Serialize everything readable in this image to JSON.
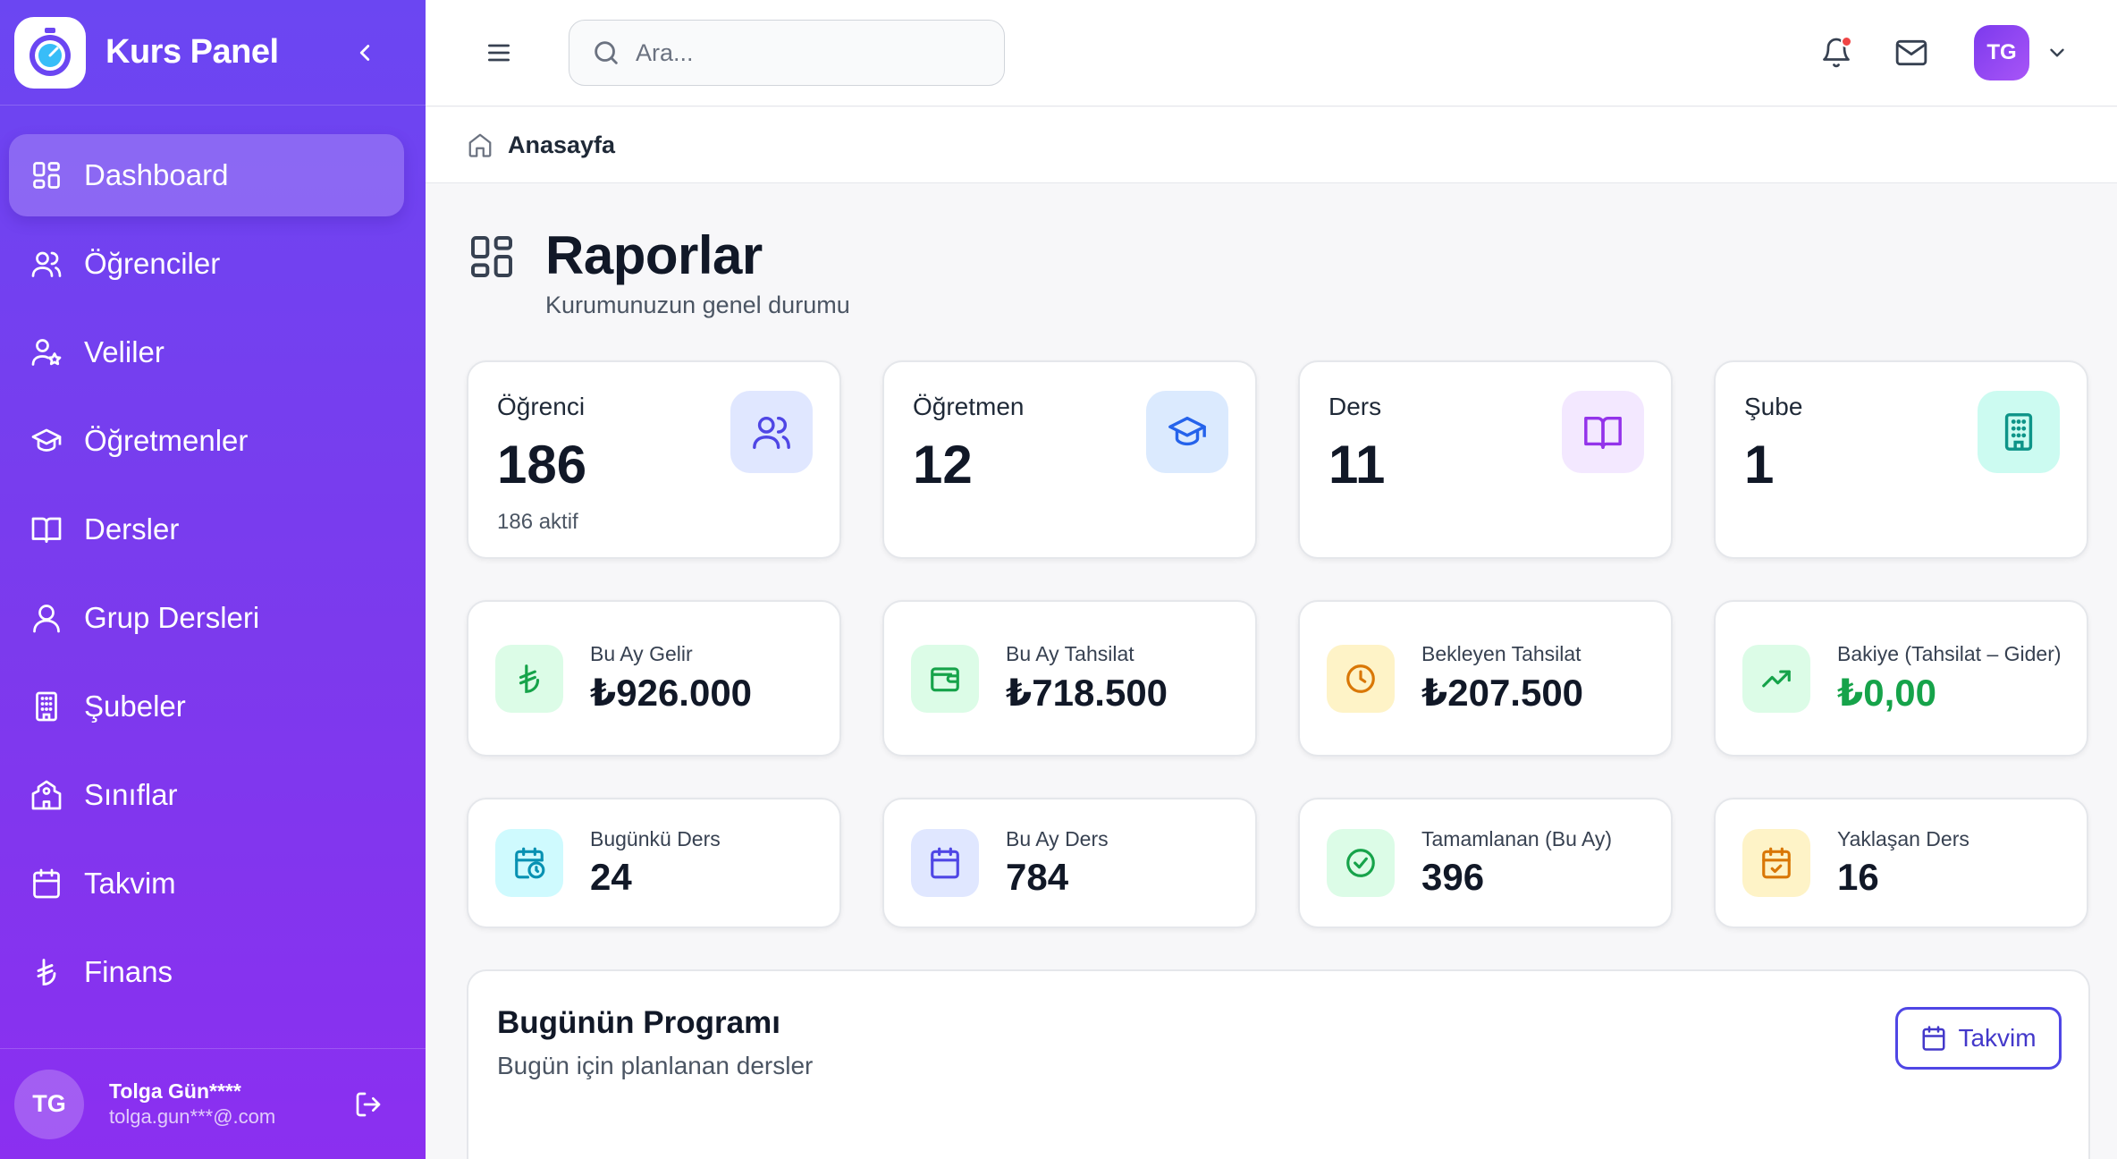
{
  "brand": {
    "title": "Kurs Panel"
  },
  "sidebar": {
    "items": [
      {
        "label": "Dashboard",
        "icon": "dashboard-icon",
        "active": true
      },
      {
        "label": "Öğrenciler",
        "icon": "users-icon"
      },
      {
        "label": "Veliler",
        "icon": "user-star-icon"
      },
      {
        "label": "Öğretmenler",
        "icon": "graduation-cap-icon"
      },
      {
        "label": "Dersler",
        "icon": "book-icon"
      },
      {
        "label": "Grup Dersleri",
        "icon": "user-icon"
      },
      {
        "label": "Şubeler",
        "icon": "building-icon"
      },
      {
        "label": "Sınıflar",
        "icon": "school-icon"
      },
      {
        "label": "Takvim",
        "icon": "calendar-icon"
      },
      {
        "label": "Finans",
        "icon": "lira-icon"
      }
    ],
    "user": {
      "initials": "TG",
      "name": "Tolga Gün****",
      "email": "tolga.gun***@.com"
    }
  },
  "header": {
    "search_placeholder": "Ara...",
    "avatar_initials": "TG"
  },
  "breadcrumb": {
    "label": "Anasayfa"
  },
  "page": {
    "title": "Raporlar",
    "subtitle": "Kurumunuzun genel durumu"
  },
  "stats": [
    {
      "label": "Öğrenci",
      "value": "186",
      "note": "186 aktif",
      "icon": "users-icon"
    },
    {
      "label": "Öğretmen",
      "value": "12",
      "note": "",
      "icon": "graduation-cap-icon"
    },
    {
      "label": "Ders",
      "value": "11",
      "note": "",
      "icon": "book-icon"
    },
    {
      "label": "Şube",
      "value": "1",
      "note": "",
      "icon": "building-icon"
    }
  ],
  "finance": [
    {
      "label": "Bu Ay Gelir",
      "value": "₺926.000",
      "icon": "lira-icon"
    },
    {
      "label": "Bu Ay Tahsilat",
      "value": "₺718.500",
      "icon": "wallet-icon"
    },
    {
      "label": "Bekleyen Tahsilat",
      "value": "₺207.500",
      "icon": "clock-icon"
    },
    {
      "label": "Bakiye (Tahsilat – Gider)",
      "value": "₺0,00",
      "icon": "trending-up-icon"
    }
  ],
  "lessons": [
    {
      "label": "Bugünkü Ders",
      "value": "24",
      "icon": "calendar-clock-icon"
    },
    {
      "label": "Bu Ay Ders",
      "value": "784",
      "icon": "calendar-icon"
    },
    {
      "label": "Tamamlanan (Bu Ay)",
      "value": "396",
      "icon": "check-circle-icon"
    },
    {
      "label": "Yaklaşan Ders",
      "value": "16",
      "icon": "calendar-check-icon"
    }
  ],
  "program": {
    "title": "Bugünün Programı",
    "subtitle": "Bugün için planlanan dersler",
    "button_label": "Takvim"
  },
  "colors": {
    "sidebar_start": "#6b46f2",
    "sidebar_end": "#8b2ff0",
    "accent": "#4f46e5",
    "positive": "#16a34a",
    "notification": "#ef4444"
  }
}
